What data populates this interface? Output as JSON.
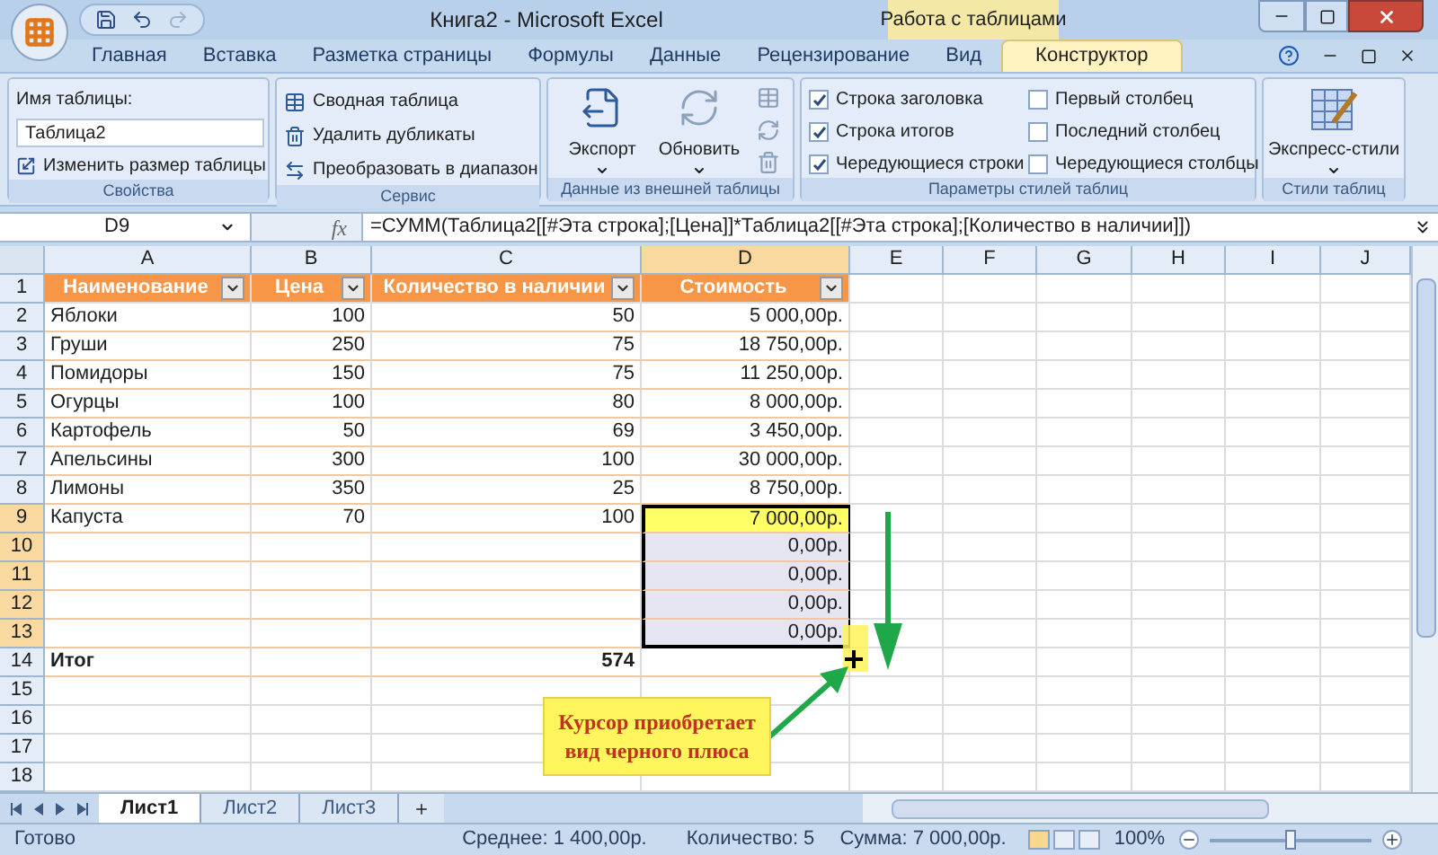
{
  "window": {
    "title": "Книга2 - Microsoft Excel",
    "context_group": "Работа с таблицами"
  },
  "ribbon_tabs": [
    {
      "label": "Главная",
      "selected": false
    },
    {
      "label": "Вставка",
      "selected": false
    },
    {
      "label": "Разметка страницы",
      "selected": false
    },
    {
      "label": "Формулы",
      "selected": false
    },
    {
      "label": "Данные",
      "selected": false
    },
    {
      "label": "Рецензирование",
      "selected": false
    },
    {
      "label": "Вид",
      "selected": false
    },
    {
      "label": "Конструктор",
      "selected": true
    }
  ],
  "properties": {
    "label": "Свойства",
    "name_label": "Имя таблицы:",
    "name_value": "Таблица2",
    "resize": "Изменить размер таблицы"
  },
  "service": {
    "label": "Сервис",
    "buttons": [
      "Сводная таблица",
      "Удалить дубликаты",
      "Преобразовать в диапазон"
    ]
  },
  "external": {
    "label": "Данные из внешней таблицы",
    "buttons": [
      "Экспорт",
      "Обновить"
    ]
  },
  "style_options": {
    "label": "Параметры стилей таблиц",
    "options": [
      {
        "label": "Строка заголовка",
        "checked": true
      },
      {
        "label": "Строка итогов",
        "checked": true
      },
      {
        "label": "Чередующиеся строки",
        "checked": true
      },
      {
        "label": "Первый столбец",
        "checked": false
      },
      {
        "label": "Последний столбец",
        "checked": false
      },
      {
        "label": "Чередующиеся столбцы",
        "checked": false
      }
    ]
  },
  "table_styles": {
    "label": "Стили таблиц",
    "button": "Экспресс-стили"
  },
  "formula_bar": {
    "name_box": "D9",
    "function_label": "fx",
    "formula": "=СУММ(Таблица2[[#Эта строка];[Цена]]*Таблица2[[#Эта строка];[Количество в наличии]])"
  },
  "columns": [
    {
      "label": "A",
      "selected": false
    },
    {
      "label": "B",
      "selected": false
    },
    {
      "label": "C",
      "selected": false
    },
    {
      "label": "D",
      "selected": true
    },
    {
      "label": "E",
      "selected": false
    },
    {
      "label": "F",
      "selected": false
    },
    {
      "label": "G",
      "selected": false
    },
    {
      "label": "H",
      "selected": false
    },
    {
      "label": "I",
      "selected": false
    },
    {
      "label": "J",
      "selected": false
    }
  ],
  "rows": [
    {
      "number": "1",
      "kind": "header",
      "selected": false,
      "active": false,
      "cells": {
        "A": "Наименование",
        "B": "Цена",
        "C": "Количество в наличии",
        "D": "Стоимость"
      }
    },
    {
      "number": "2",
      "kind": "data",
      "selected": false,
      "active": false,
      "cells": {
        "A": "Яблоки",
        "B": "100",
        "C": "50",
        "D": "5 000,00р."
      }
    },
    {
      "number": "3",
      "kind": "data",
      "selected": false,
      "active": false,
      "cells": {
        "A": "Груши",
        "B": "250",
        "C": "75",
        "D": "18 750,00р."
      }
    },
    {
      "number": "4",
      "kind": "data",
      "selected": false,
      "active": false,
      "cells": {
        "A": "Помидоры",
        "B": "150",
        "C": "75",
        "D": "11 250,00р."
      }
    },
    {
      "number": "5",
      "kind": "data",
      "selected": false,
      "active": false,
      "cells": {
        "A": "Огурцы",
        "B": "100",
        "C": "80",
        "D": "8 000,00р."
      }
    },
    {
      "number": "6",
      "kind": "data",
      "selected": false,
      "active": false,
      "cells": {
        "A": "Картофель",
        "B": "50",
        "C": "69",
        "D": "3 450,00р."
      }
    },
    {
      "number": "7",
      "kind": "data",
      "selected": false,
      "active": false,
      "cells": {
        "A": "Апельсины",
        "B": "300",
        "C": "100",
        "D": "30 000,00р."
      }
    },
    {
      "number": "8",
      "kind": "data",
      "selected": false,
      "active": false,
      "cells": {
        "A": "Лимоны",
        "B": "350",
        "C": "25",
        "D": "8 750,00р."
      }
    },
    {
      "number": "9",
      "kind": "data",
      "selected": true,
      "active": true,
      "cells": {
        "A": "Капуста",
        "B": "70",
        "C": "100",
        "D": "7 000,00р."
      }
    },
    {
      "number": "10",
      "kind": "data",
      "selected": true,
      "active": false,
      "cells": {
        "D": "0,00р."
      }
    },
    {
      "number": "11",
      "kind": "data",
      "selected": true,
      "active": false,
      "cells": {
        "D": "0,00р."
      }
    },
    {
      "number": "12",
      "kind": "data",
      "selected": true,
      "active": false,
      "cells": {
        "D": "0,00р."
      }
    },
    {
      "number": "13",
      "kind": "data",
      "selected": true,
      "active": false,
      "cells": {
        "D": "0,00р."
      }
    },
    {
      "number": "14",
      "kind": "total",
      "selected": false,
      "active": false,
      "cells": {
        "A": "Итог",
        "C": "574"
      }
    },
    {
      "number": "15",
      "kind": "empty",
      "selected": false,
      "active": false
    },
    {
      "number": "16",
      "kind": "empty",
      "selected": false,
      "active": false
    },
    {
      "number": "17",
      "kind": "empty",
      "selected": false,
      "active": false
    },
    {
      "number": "18",
      "kind": "empty",
      "selected": false,
      "active": false
    }
  ],
  "annotation": {
    "text": "Курсор приобретает вид черного плюса"
  },
  "sheet_tabs": [
    {
      "label": "Лист1",
      "selected": true
    },
    {
      "label": "Лист2",
      "selected": false
    },
    {
      "label": "Лист3",
      "selected": false
    }
  ],
  "status_bar": {
    "status": "Готово",
    "average": "Среднее: 1 400,00р.",
    "count": "Количество: 5",
    "sum": "Сумма: 7 000,00р.",
    "zoom": "100%",
    "zoom_slider": {
      "level": 0.5
    }
  }
}
